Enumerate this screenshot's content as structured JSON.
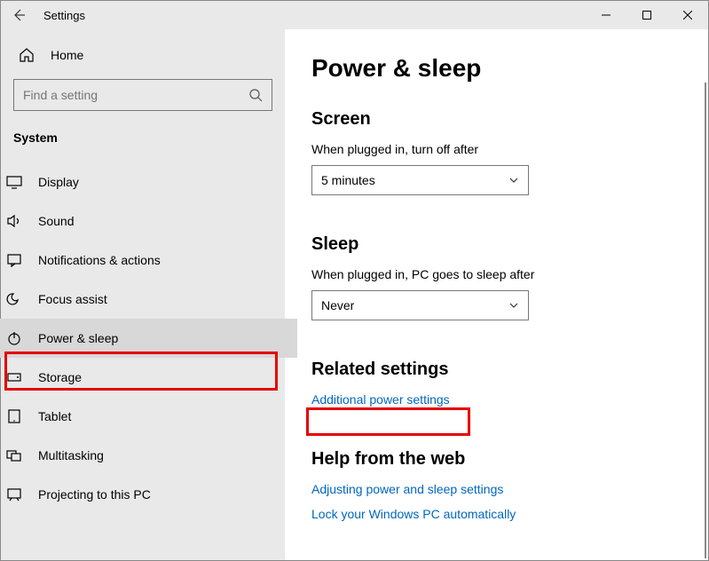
{
  "window": {
    "title": "Settings"
  },
  "sidebar": {
    "home_label": "Home",
    "search_placeholder": "Find a setting",
    "group_label": "System",
    "items": [
      {
        "label": "Display"
      },
      {
        "label": "Sound"
      },
      {
        "label": "Notifications & actions"
      },
      {
        "label": "Focus assist"
      },
      {
        "label": "Power & sleep"
      },
      {
        "label": "Storage"
      },
      {
        "label": "Tablet"
      },
      {
        "label": "Multitasking"
      },
      {
        "label": "Projecting to this PC"
      }
    ]
  },
  "main": {
    "title": "Power & sleep",
    "screen": {
      "heading": "Screen",
      "label": "When plugged in, turn off after",
      "value": "5 minutes"
    },
    "sleep": {
      "heading": "Sleep",
      "label": "When plugged in, PC goes to sleep after",
      "value": "Never"
    },
    "related": {
      "heading": "Related settings",
      "link1": "Additional power settings"
    },
    "help": {
      "heading": "Help from the web",
      "link1": "Adjusting power and sleep settings",
      "link2": "Lock your Windows PC automatically"
    }
  }
}
